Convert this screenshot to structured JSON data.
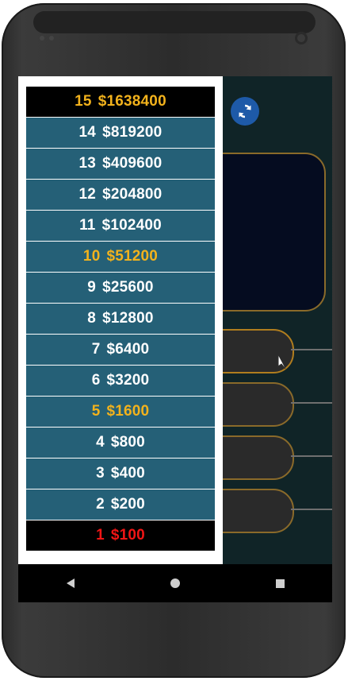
{
  "ladder": [
    {
      "level": "15",
      "amount": "$1638400",
      "style": "top"
    },
    {
      "level": "14",
      "amount": "$819200",
      "style": "normal"
    },
    {
      "level": "13",
      "amount": "$409600",
      "style": "normal"
    },
    {
      "level": "12",
      "amount": "$204800",
      "style": "normal"
    },
    {
      "level": "11",
      "amount": "$102400",
      "style": "normal"
    },
    {
      "level": "10",
      "amount": "$51200",
      "style": "milestone"
    },
    {
      "level": "9",
      "amount": "$25600",
      "style": "normal"
    },
    {
      "level": "8",
      "amount": "$12800",
      "style": "normal"
    },
    {
      "level": "7",
      "amount": "$6400",
      "style": "normal"
    },
    {
      "level": "6",
      "amount": "$3200",
      "style": "normal"
    },
    {
      "level": "5",
      "amount": "$1600",
      "style": "milestone"
    },
    {
      "level": "4",
      "amount": "$800",
      "style": "normal"
    },
    {
      "level": "3",
      "amount": "$400",
      "style": "normal"
    },
    {
      "level": "2",
      "amount": "$200",
      "style": "normal"
    },
    {
      "level": "1",
      "amount": "$100",
      "style": "bottom"
    }
  ],
  "icons": {
    "refresh": "refresh-icon",
    "nav_back": "back-icon",
    "nav_home": "home-icon",
    "nav_recent": "recent-apps-icon"
  },
  "colors": {
    "rung_bg": "#256077",
    "milestone_text": "#f2b21c",
    "bottom_text": "#f01515",
    "answer_border": "#8a6a2a"
  }
}
